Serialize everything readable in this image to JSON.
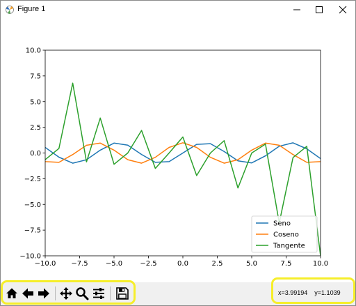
{
  "window": {
    "title": "Figure 1",
    "controls": [
      "minimize-icon",
      "maximize-icon",
      "close-icon"
    ]
  },
  "toolbar": {
    "buttons": [
      {
        "name": "home",
        "icon": "home-icon"
      },
      {
        "name": "back",
        "icon": "arrow-left-icon"
      },
      {
        "name": "forward",
        "icon": "arrow-right-icon"
      },
      {
        "name": "pan",
        "icon": "move-icon"
      },
      {
        "name": "zoom",
        "icon": "magnifier-icon"
      },
      {
        "name": "configure-subplots",
        "icon": "sliders-icon"
      },
      {
        "name": "save",
        "icon": "floppy-disk-icon"
      }
    ],
    "coords_x": "x=3.99194",
    "coords_y": "y=1.1039"
  },
  "highlight_color": "#f6ee2a",
  "chart_data": {
    "type": "line",
    "title": "",
    "xlabel": "",
    "ylabel": "",
    "xlim": [
      -10,
      10
    ],
    "ylim": [
      -10,
      10
    ],
    "xticks": [
      "−10.0",
      "−7.5",
      "−5.0",
      "−2.5",
      "0.0",
      "2.5",
      "5.0",
      "7.5",
      "10.0"
    ],
    "xtick_values": [
      -10,
      -7.5,
      -5,
      -2.5,
      0,
      2.5,
      5,
      7.5,
      10
    ],
    "yticks": [
      "10.0",
      "7.5",
      "5.0",
      "2.5",
      "0.0",
      "−2.5",
      "−5.0",
      "−7.5",
      "−10.0"
    ],
    "ytick_values": [
      10,
      7.5,
      5,
      2.5,
      0,
      -2.5,
      -5,
      -7.5,
      -10
    ],
    "legend_position": "lower-right",
    "x": [
      -10,
      -9,
      -8,
      -7,
      -6,
      -5,
      -4,
      -3,
      -2,
      -1,
      0,
      1,
      2,
      3,
      4,
      5,
      6,
      7,
      8,
      9,
      10
    ],
    "series": [
      {
        "name": "Seno",
        "color": "#1f77b4",
        "values": [
          0.54,
          -0.41,
          -0.99,
          -0.66,
          0.28,
          0.96,
          0.76,
          -0.14,
          -0.91,
          -0.84,
          0.0,
          0.84,
          0.91,
          0.14,
          -0.76,
          -0.96,
          -0.28,
          0.66,
          0.99,
          0.41,
          -0.54
        ]
      },
      {
        "name": "Coseno",
        "color": "#ff7f0e",
        "values": [
          -0.84,
          -0.91,
          -0.15,
          0.75,
          0.96,
          0.28,
          -0.65,
          -0.99,
          -0.42,
          0.54,
          1.0,
          0.54,
          -0.42,
          -0.99,
          -0.65,
          0.28,
          0.96,
          0.75,
          -0.15,
          -0.91,
          -0.84
        ]
      },
      {
        "name": "Tangente",
        "color": "#2ca02c",
        "values": [
          -0.65,
          0.45,
          6.8,
          -0.87,
          3.4,
          -1.1,
          0.0,
          2.2,
          -1.5,
          0.0,
          1.56,
          -2.2,
          0.0,
          1.2,
          -3.4,
          0.0,
          0.87,
          -6.8,
          -0.45,
          0.65,
          -10.0
        ]
      }
    ]
  }
}
